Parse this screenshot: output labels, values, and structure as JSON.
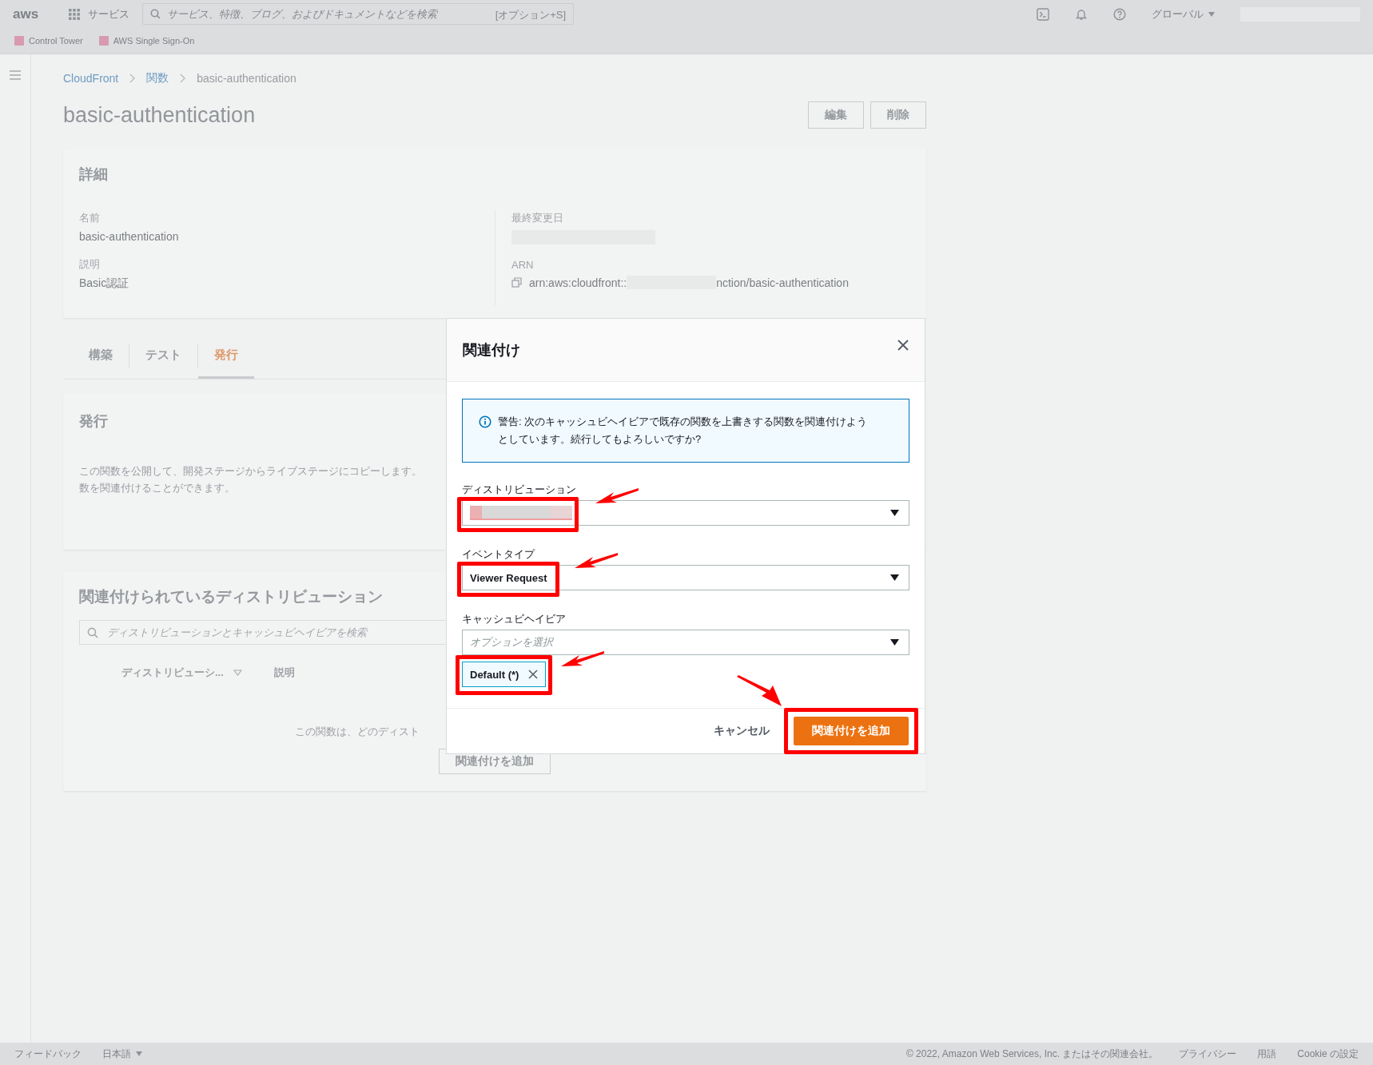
{
  "top_nav": {
    "logo": "aws",
    "services_label": "サービス",
    "search": {
      "placeholder": "サービス、特徴、ブログ、およびドキュメントなどを検索",
      "shortcut": "[オプション+S]"
    },
    "region": "グローバル"
  },
  "favorites": [
    {
      "label": "Control Tower"
    },
    {
      "label": "AWS Single Sign-On"
    }
  ],
  "breadcrumbs": [
    "CloudFront",
    "関数",
    "basic-authentication"
  ],
  "page_title": "basic-authentication",
  "header_buttons": [
    "編集",
    "削除"
  ],
  "details": {
    "title": "詳細",
    "left": [
      {
        "label": "名前",
        "value": "basic-authentication"
      },
      {
        "label": "説明",
        "value": "Basic認証"
      }
    ],
    "last_modified_label": "最終変更日",
    "arn": {
      "label": "ARN",
      "value_start": "arn:aws:cloudfront::",
      "value_end": "nction/basic-authentication"
    }
  },
  "tabs": [
    {
      "label": "構築",
      "selected": false
    },
    {
      "label": "テスト",
      "selected": false
    },
    {
      "label": "発行",
      "selected": true
    }
  ],
  "publish": {
    "title": "発行",
    "lines": [
      "この関数を公開して、開発ステージからライブステージにコピーします。",
      "数を関連付けることができます。"
    ]
  },
  "associations": {
    "title": "関連付けられているディストリビューション",
    "search_placeholder": "ディストリビューションとキャッシュビヘイビアを検索",
    "columns": [
      "ディストリビューシ...",
      "説明"
    ],
    "empty_text": "この関数は、どのディスト",
    "add_button": "関連付けを追加"
  },
  "modal": {
    "title": "関連付け",
    "alert": "警告: 次のキャッシュビヘイビアで既存の関数を上書きする関数を関連付けようとしています。続行してもよろしいですか?",
    "fields": [
      {
        "label": "ディストリビューション",
        "kind": "redacted",
        "highlighted": true
      },
      {
        "label": "イベントタイプ",
        "kind": "value",
        "value": "Viewer Request",
        "highlighted": true
      },
      {
        "label": "キャッシュビヘイビア",
        "kind": "placeholder",
        "placeholder": "オプションを選択",
        "highlighted": false,
        "tokens": [
          {
            "label": "Default (*)",
            "highlighted": true
          }
        ]
      }
    ],
    "cancel_button": "キャンセル",
    "primary_button": {
      "label": "関連付けを追加",
      "highlighted": true
    }
  },
  "footer": {
    "feedback": "フィードバック",
    "language": "日本語",
    "copyright": "© 2022, Amazon Web Services, Inc. またはその関連会社。",
    "links": [
      "プライバシー",
      "用語",
      "Cookie の設定"
    ]
  }
}
